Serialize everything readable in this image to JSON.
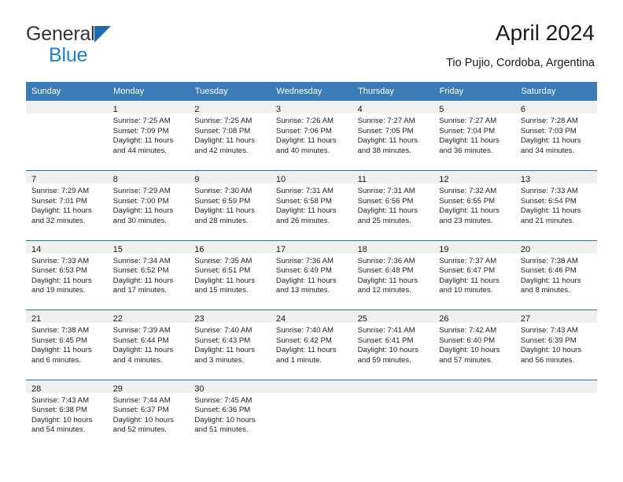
{
  "brand": {
    "name_part1": "General",
    "name_part2": "Blue",
    "triangle_color": "#1a6bb0",
    "blue_color": "#1a82d6"
  },
  "header": {
    "title": "April 2024",
    "subtitle": "Tio Pujio, Cordoba, Argentina"
  },
  "theme": {
    "header_blue": "#3a7cb8",
    "row_separator_blue": "#2f6fa8",
    "daynum_strip_grey": "#f0f0f0"
  },
  "calendar": {
    "weekday_headers": [
      "Sunday",
      "Monday",
      "Tuesday",
      "Wednesday",
      "Thursday",
      "Friday",
      "Saturday"
    ],
    "weeks": [
      [
        {
          "day": "",
          "lines": []
        },
        {
          "day": "1",
          "lines": [
            "Sunrise: 7:25 AM",
            "Sunset: 7:09 PM",
            "Daylight: 11 hours",
            "and 44 minutes."
          ]
        },
        {
          "day": "2",
          "lines": [
            "Sunrise: 7:25 AM",
            "Sunset: 7:08 PM",
            "Daylight: 11 hours",
            "and 42 minutes."
          ]
        },
        {
          "day": "3",
          "lines": [
            "Sunrise: 7:26 AM",
            "Sunset: 7:06 PM",
            "Daylight: 11 hours",
            "and 40 minutes."
          ]
        },
        {
          "day": "4",
          "lines": [
            "Sunrise: 7:27 AM",
            "Sunset: 7:05 PM",
            "Daylight: 11 hours",
            "and 38 minutes."
          ]
        },
        {
          "day": "5",
          "lines": [
            "Sunrise: 7:27 AM",
            "Sunset: 7:04 PM",
            "Daylight: 11 hours",
            "and 36 minutes."
          ]
        },
        {
          "day": "6",
          "lines": [
            "Sunrise: 7:28 AM",
            "Sunset: 7:03 PM",
            "Daylight: 11 hours",
            "and 34 minutes."
          ]
        }
      ],
      [
        {
          "day": "7",
          "lines": [
            "Sunrise: 7:29 AM",
            "Sunset: 7:01 PM",
            "Daylight: 11 hours",
            "and 32 minutes."
          ]
        },
        {
          "day": "8",
          "lines": [
            "Sunrise: 7:29 AM",
            "Sunset: 7:00 PM",
            "Daylight: 11 hours",
            "and 30 minutes."
          ]
        },
        {
          "day": "9",
          "lines": [
            "Sunrise: 7:30 AM",
            "Sunset: 6:59 PM",
            "Daylight: 11 hours",
            "and 28 minutes."
          ]
        },
        {
          "day": "10",
          "lines": [
            "Sunrise: 7:31 AM",
            "Sunset: 6:58 PM",
            "Daylight: 11 hours",
            "and 26 minutes."
          ]
        },
        {
          "day": "11",
          "lines": [
            "Sunrise: 7:31 AM",
            "Sunset: 6:56 PM",
            "Daylight: 11 hours",
            "and 25 minutes."
          ]
        },
        {
          "day": "12",
          "lines": [
            "Sunrise: 7:32 AM",
            "Sunset: 6:55 PM",
            "Daylight: 11 hours",
            "and 23 minutes."
          ]
        },
        {
          "day": "13",
          "lines": [
            "Sunrise: 7:33 AM",
            "Sunset: 6:54 PM",
            "Daylight: 11 hours",
            "and 21 minutes."
          ]
        }
      ],
      [
        {
          "day": "14",
          "lines": [
            "Sunrise: 7:33 AM",
            "Sunset: 6:53 PM",
            "Daylight: 11 hours",
            "and 19 minutes."
          ]
        },
        {
          "day": "15",
          "lines": [
            "Sunrise: 7:34 AM",
            "Sunset: 6:52 PM",
            "Daylight: 11 hours",
            "and 17 minutes."
          ]
        },
        {
          "day": "16",
          "lines": [
            "Sunrise: 7:35 AM",
            "Sunset: 6:51 PM",
            "Daylight: 11 hours",
            "and 15 minutes."
          ]
        },
        {
          "day": "17",
          "lines": [
            "Sunrise: 7:36 AM",
            "Sunset: 6:49 PM",
            "Daylight: 11 hours",
            "and 13 minutes."
          ]
        },
        {
          "day": "18",
          "lines": [
            "Sunrise: 7:36 AM",
            "Sunset: 6:48 PM",
            "Daylight: 11 hours",
            "and 12 minutes."
          ]
        },
        {
          "day": "19",
          "lines": [
            "Sunrise: 7:37 AM",
            "Sunset: 6:47 PM",
            "Daylight: 11 hours",
            "and 10 minutes."
          ]
        },
        {
          "day": "20",
          "lines": [
            "Sunrise: 7:38 AM",
            "Sunset: 6:46 PM",
            "Daylight: 11 hours",
            "and 8 minutes."
          ]
        }
      ],
      [
        {
          "day": "21",
          "lines": [
            "Sunrise: 7:38 AM",
            "Sunset: 6:45 PM",
            "Daylight: 11 hours",
            "and 6 minutes."
          ]
        },
        {
          "day": "22",
          "lines": [
            "Sunrise: 7:39 AM",
            "Sunset: 6:44 PM",
            "Daylight: 11 hours",
            "and 4 minutes."
          ]
        },
        {
          "day": "23",
          "lines": [
            "Sunrise: 7:40 AM",
            "Sunset: 6:43 PM",
            "Daylight: 11 hours",
            "and 3 minutes."
          ]
        },
        {
          "day": "24",
          "lines": [
            "Sunrise: 7:40 AM",
            "Sunset: 6:42 PM",
            "Daylight: 11 hours",
            "and 1 minute."
          ]
        },
        {
          "day": "25",
          "lines": [
            "Sunrise: 7:41 AM",
            "Sunset: 6:41 PM",
            "Daylight: 10 hours",
            "and 59 minutes."
          ]
        },
        {
          "day": "26",
          "lines": [
            "Sunrise: 7:42 AM",
            "Sunset: 6:40 PM",
            "Daylight: 10 hours",
            "and 57 minutes."
          ]
        },
        {
          "day": "27",
          "lines": [
            "Sunrise: 7:43 AM",
            "Sunset: 6:39 PM",
            "Daylight: 10 hours",
            "and 56 minutes."
          ]
        }
      ],
      [
        {
          "day": "28",
          "lines": [
            "Sunrise: 7:43 AM",
            "Sunset: 6:38 PM",
            "Daylight: 10 hours",
            "and 54 minutes."
          ]
        },
        {
          "day": "29",
          "lines": [
            "Sunrise: 7:44 AM",
            "Sunset: 6:37 PM",
            "Daylight: 10 hours",
            "and 52 minutes."
          ]
        },
        {
          "day": "30",
          "lines": [
            "Sunrise: 7:45 AM",
            "Sunset: 6:36 PM",
            "Daylight: 10 hours",
            "and 51 minutes."
          ]
        },
        {
          "day": "",
          "lines": []
        },
        {
          "day": "",
          "lines": []
        },
        {
          "day": "",
          "lines": []
        },
        {
          "day": "",
          "lines": []
        }
      ]
    ]
  }
}
